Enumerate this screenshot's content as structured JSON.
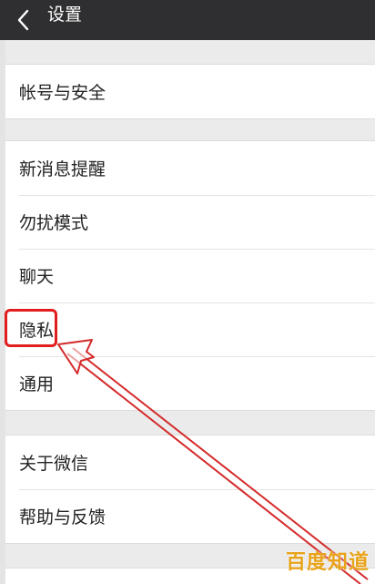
{
  "header": {
    "title": "设置"
  },
  "groups": [
    {
      "items": [
        {
          "label": "帐号与安全"
        }
      ]
    },
    {
      "items": [
        {
          "label": "新消息提醒"
        },
        {
          "label": "勿扰模式"
        },
        {
          "label": "聊天"
        },
        {
          "label": "隐私"
        },
        {
          "label": "通用"
        }
      ]
    },
    {
      "items": [
        {
          "label": "关于微信"
        },
        {
          "label": "帮助与反馈"
        }
      ]
    }
  ],
  "annotation": {
    "highlighted_item": "隐私",
    "color": "#e21d1d"
  },
  "watermark": {
    "text": "百度知道"
  }
}
